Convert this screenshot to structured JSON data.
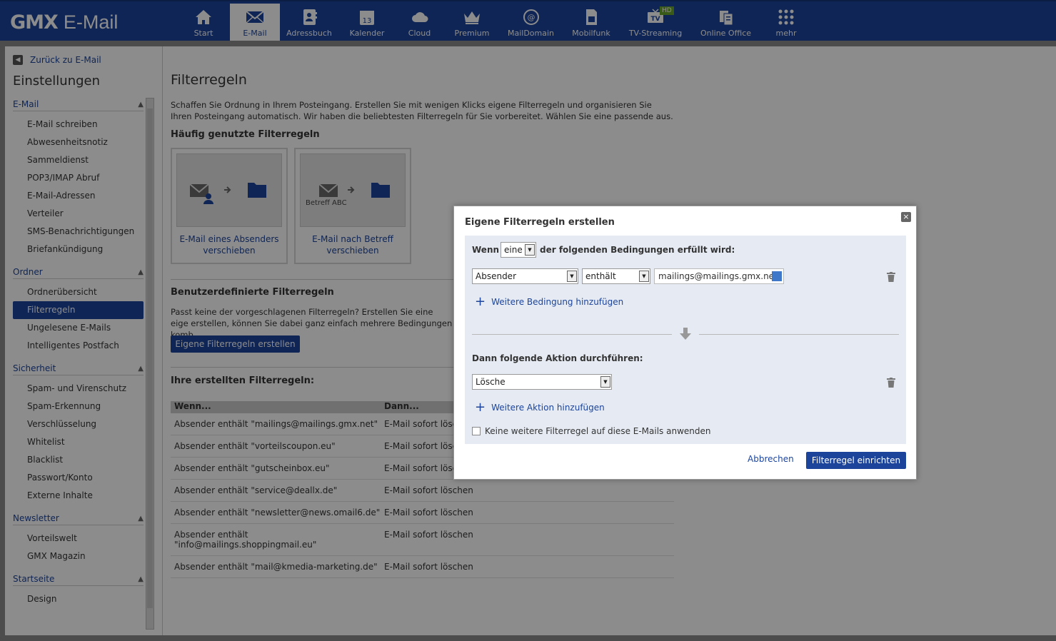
{
  "header": {
    "brand": "GMX",
    "product": "E-Mail",
    "nav": [
      {
        "label": "Start",
        "icon": "home-icon"
      },
      {
        "label": "E-Mail",
        "icon": "envelope-icon",
        "active": true
      },
      {
        "label": "Adressbuch",
        "icon": "addressbook-icon"
      },
      {
        "label": "Kalender",
        "icon": "calendar-icon",
        "badge": "13"
      },
      {
        "label": "Cloud",
        "icon": "cloud-icon"
      },
      {
        "label": "Premium",
        "icon": "crown-icon"
      },
      {
        "label": "MailDomain",
        "icon": "maildomain-icon"
      },
      {
        "label": "Mobilfunk",
        "icon": "sim-icon"
      },
      {
        "label": "TV-Streaming",
        "icon": "tv-icon",
        "badge": "HD",
        "tv": "TV"
      },
      {
        "label": "Online Office",
        "icon": "office-icon"
      },
      {
        "label": "mehr",
        "icon": "grid-icon"
      }
    ]
  },
  "sidebar": {
    "back": "Zurück zu E-Mail",
    "title": "Einstellungen",
    "sections": [
      {
        "head": "E-Mail",
        "items": [
          "E-Mail schreiben",
          "Abwesenheitsnotiz",
          "Sammeldienst",
          "POP3/IMAP Abruf",
          "E-Mail-Adressen",
          "Verteiler",
          "SMS-Benachrichtigungen",
          "Briefankündigung"
        ]
      },
      {
        "head": "Ordner",
        "items": [
          "Ordnerübersicht",
          "Filterregeln",
          "Ungelesene E-Mails",
          "Intelligentes Postfach"
        ]
      },
      {
        "head": "Sicherheit",
        "items": [
          "Spam- und Virenschutz",
          "Spam-Erkennung",
          "Verschlüsselung",
          "Whitelist",
          "Blacklist",
          "Passwort/Konto",
          "Externe Inhalte"
        ]
      },
      {
        "head": "Newsletter",
        "items": [
          "Vorteilswelt",
          "GMX Magazin"
        ]
      },
      {
        "head": "Startseite",
        "items": [
          "Design"
        ]
      }
    ],
    "active_item": "Filterregeln"
  },
  "main": {
    "title": "Filterregeln",
    "intro": "Schaffen Sie Ordnung in Ihrem Posteingang. Erstellen Sie mit wenigen Klicks eigene Filterregeln und organisieren Sie Ihren Posteingang automatisch. Wir haben die beliebtesten Filterregeln für Sie vorbereitet. Wählen Sie eine passende aus.",
    "frequent_title": "Häufig genutzte Filterregeln",
    "cards": [
      {
        "caption": "E-Mail eines Absenders verschieben",
        "pic_label": ""
      },
      {
        "caption": "E-Mail nach Betreff verschieben",
        "pic_label": "Betreff ABC"
      }
    ],
    "custom_title": "Benutzerdefinierte Filterregeln",
    "custom_text": "Passt keine der vorgeschlagenen Filterregeln? Erstellen Sie eine eige erstellen, können Sie dabei ganz einfach mehrere Bedingungen komb",
    "create_button": "Eigene Filterregeln erstellen",
    "your_rules_title": "Ihre erstellten Filterregeln:",
    "table": {
      "headers": [
        "Wenn...",
        "Dann..."
      ],
      "rows": [
        [
          "Absender enthält \"mailings@mailings.gmx.net\"",
          "E-Mail sofort lösc"
        ],
        [
          "Absender enthält \"vorteilscoupon.eu\"",
          "E-Mail sofort lösc"
        ],
        [
          "Absender enthält \"gutscheinbox.eu\"",
          "E-Mail sofort lösc"
        ],
        [
          "Absender enthält \"service@deallx.de\"",
          "E-Mail sofort löschen"
        ],
        [
          "Absender enthält \"newsletter@news.omail6.de\"",
          "E-Mail sofort löschen"
        ],
        [
          "Absender enthält \"info@mailings.shoppingmail.eu\"",
          "E-Mail sofort löschen"
        ],
        [
          "Absender enthält \"mail@kmedia-marketing.de\"",
          "E-Mail sofort löschen"
        ]
      ]
    }
  },
  "modal": {
    "title": "Eigene Filterregeln erstellen",
    "close": "×",
    "wenn": "Wenn",
    "match_mode": "eine",
    "condition_suffix": "der folgenden Bedingungen erfüllt wird:",
    "field": "Absender",
    "operator": "enthält",
    "value": "mailings@mailings.gmx.net",
    "add_condition": "Weitere Bedingung hinzufügen",
    "action_title": "Dann folgende Aktion durchführen:",
    "action": "Lösche",
    "add_action": "Weitere Aktion hinzufügen",
    "stop_checkbox": "Keine weitere Filterregel auf diese E-Mails anwenden",
    "cancel": "Abbrechen",
    "submit": "Filterregel einrichten",
    "plus": "+"
  },
  "colors": {
    "brand": "#1c449b",
    "overlay": "rgba(0,0,0,0.45)"
  }
}
